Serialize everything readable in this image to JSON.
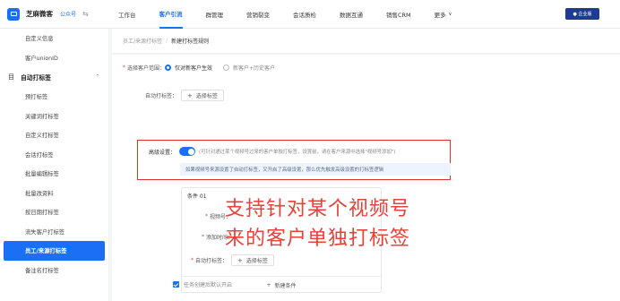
{
  "topbar": {
    "brand_name": "芝麻微客",
    "brand_sub": "公众号",
    "brand_toggle": "⇆",
    "nav": [
      "工作台",
      "客户引流",
      "群管理",
      "营销裂变",
      "会话质检",
      "数据互通",
      "销售CRM",
      "更多"
    ],
    "nav_active_index": 1,
    "more_chevron": "∨",
    "enterprise_badge": "● 企业版"
  },
  "sidebar": {
    "items_top": [
      "自定义信息",
      "客户unionID"
    ],
    "group": {
      "icon": "目",
      "label": "自动打标签",
      "chevron": "^"
    },
    "items": [
      "预打标签",
      "关键词打标签",
      "自定义打标签",
      "会话打标签",
      "批量编辑标签",
      "批量改资料",
      "按日期打标签",
      "流失客户打标签",
      "员工/来源打标签",
      "备注名打标签"
    ],
    "active_item": "员工/来源打标签"
  },
  "breadcrumb": {
    "parent": "员工/来源打标签",
    "separator": "/",
    "current": "新建打标签规则"
  },
  "form": {
    "scope": {
      "label": "选择客户范围：",
      "option_on": "仅对新客户生效",
      "option_off": "新客户+历史客户"
    },
    "auto_tag": {
      "label": "自动打标签：",
      "button": "选择标签"
    },
    "advanced": {
      "label": "高级设置：",
      "hint": "(可针对通过某个视频号过来的客户单独打标签，设置前，请在客户来源中选择\"视频号添加\")",
      "info": "如果视频号来源设置了自动打标签，又开启了高级设置，那么优先触发高级设置的打标签逻辑",
      "enabled": true
    },
    "condition": {
      "title": "条件 01",
      "row1_label": "视频号：",
      "row2_label": "添加时间：",
      "row3_label": "自动打标签：",
      "row3_button": "选择标签",
      "add_button": "新建条件"
    },
    "overlay_lines": [
      "支持针对某个视频号",
      "来的客户单独打标签"
    ],
    "task_checkbox": "任务创建后默认开启"
  },
  "colors": {
    "accent": "#1a6ff5",
    "overlay": "#e8413a",
    "highlight_border": "#d9332b",
    "enterprise_bg": "#1f3a93"
  }
}
